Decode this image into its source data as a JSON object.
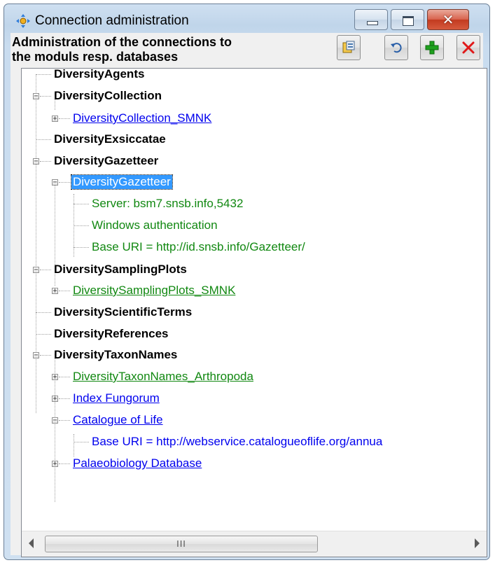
{
  "window": {
    "title": "Connection administration",
    "icon": "connection-gear-icon",
    "controls": {
      "minimize": "minimize-icon",
      "maximize": "maximize-icon",
      "close_glyph": "✕"
    }
  },
  "header": {
    "description": "Administration of the connections to\nthe moduls resp. databases"
  },
  "toolbar": [
    {
      "name": "copy-connection-button",
      "icon": "database-copy-icon"
    },
    {
      "name": "undo-button",
      "icon": "undo-icon"
    },
    {
      "name": "add-connection-button",
      "icon": "plus-icon"
    },
    {
      "name": "remove-connection-button",
      "icon": "close-red-icon"
    }
  ],
  "tree": {
    "nodes": [
      {
        "label": "DiversityAgents",
        "style": "bold"
      },
      {
        "label": "DiversityCollection",
        "style": "bold",
        "expanded": true
      },
      {
        "label": "DiversityCollection_SMNK",
        "style": "blue"
      },
      {
        "label": "DiversityExsiccatae",
        "style": "bold"
      },
      {
        "label": "DiversityGazetteer",
        "style": "bold",
        "expanded": true
      },
      {
        "label": "DiversityGazetteer",
        "style": "selected",
        "expanded": true
      },
      {
        "label": "Server: bsm7.snsb.info,5432",
        "style": "greenplain"
      },
      {
        "label": "Windows authentication",
        "style": "greenplain"
      },
      {
        "label": "Base URI = http://id.snsb.info/Gazetteer/",
        "style": "greenplain"
      },
      {
        "label": "DiversitySamplingPlots",
        "style": "bold",
        "expanded": true
      },
      {
        "label": "DiversitySamplingPlots_SMNK",
        "style": "green"
      },
      {
        "label": "DiversityScientificTerms",
        "style": "bold"
      },
      {
        "label": "DiversityReferences",
        "style": "bold"
      },
      {
        "label": "DiversityTaxonNames",
        "style": "bold",
        "expanded": true
      },
      {
        "label": "DiversityTaxonNames_Arthropoda",
        "style": "green"
      },
      {
        "label": "Index Fungorum",
        "style": "blue"
      },
      {
        "label": "Catalogue of Life",
        "style": "blue",
        "expanded": true
      },
      {
        "label": "Base URI = http://webservice.catalogueoflife.org/annua",
        "style": "blueplain"
      },
      {
        "label": "Palaeobiology Database",
        "style": "blue"
      }
    ]
  },
  "scrollbar": {
    "grip": "III"
  }
}
